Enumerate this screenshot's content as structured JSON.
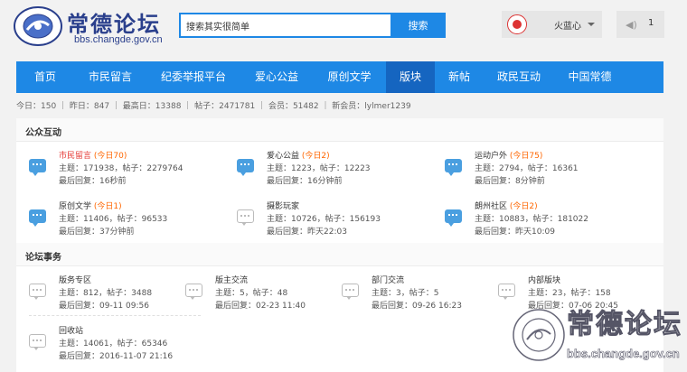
{
  "site": {
    "title": "常德论坛",
    "url": "bbs.changde.gov.cn"
  },
  "search": {
    "value": "搜索其实很简单",
    "button": "搜索"
  },
  "user": {
    "name": "火蓝心",
    "messages": "1"
  },
  "nav": [
    "首页",
    "市民留言",
    "纪委举报平台",
    "爱心公益",
    "原创文学",
    "版块",
    "新帖",
    "政民互动",
    "中国常德"
  ],
  "nav_active": 5,
  "stats": "今日：150 ｜ 昨日：847 ｜ 最高日：13388 ｜ 帖子：2471781 ｜ 会员：51482 ｜ 新会员：lylmer1239",
  "sections": {
    "public": {
      "title": "公众互动",
      "forums": [
        {
          "name": "市民留言",
          "today": "(今日70)",
          "meta": "主题：171938，帖子：2279764",
          "last": "最后回复：16秒前"
        },
        {
          "name": "爱心公益",
          "today": "(今日2)",
          "meta": "主题：1223，帖子：12223",
          "last": "最后回复：16分钟前"
        },
        {
          "name": "运动户外",
          "today": "(今日75)",
          "meta": "主题：2794，帖子：16361",
          "last": "最后回复：8分钟前"
        },
        {
          "name": "原创文学",
          "today": "(今日1)",
          "meta": "主题：11406，帖子：96533",
          "last": "最后回复：37分钟前"
        },
        {
          "name": "摄影玩家",
          "today": "",
          "meta": "主题：10726，帖子：156193",
          "last": "最后回复：昨天22:03"
        },
        {
          "name": "朗州社区",
          "today": "(今日2)",
          "meta": "主题：10883，帖子：181022",
          "last": "最后回复：昨天10:09"
        }
      ]
    },
    "affairs": {
      "title": "论坛事务",
      "forums": [
        {
          "name": "版务专区",
          "meta": "主题：812，帖子：3488",
          "last": "最后回复：09-11 09:56"
        },
        {
          "name": "版主交流",
          "meta": "主题：5，帖子：48",
          "last": "最后回复：02-23 11:40"
        },
        {
          "name": "部门交流",
          "meta": "主题：3，帖子：5",
          "last": "最后回复：09-26 16:23"
        },
        {
          "name": "内部版块",
          "meta": "主题：23，帖子：158",
          "last": "最后回复：07-06 20:45"
        },
        {
          "name": "回收站",
          "meta": "主题：14061，帖子：65346",
          "last": "最后回复：2016-11-07 21:16"
        }
      ]
    }
  },
  "watermark": {
    "title": "常德论坛",
    "url": "bbs.changde.gov.cn"
  }
}
